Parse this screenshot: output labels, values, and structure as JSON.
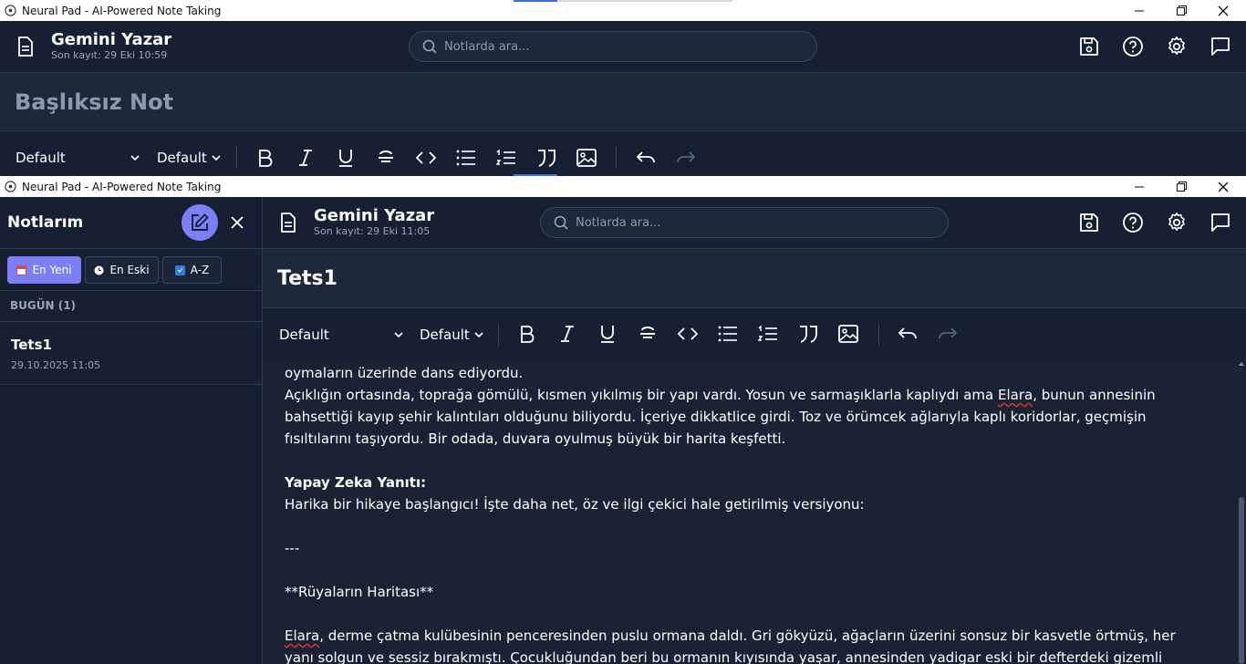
{
  "back_window": {
    "window_title": "Neural Pad - AI-Powered Note Taking",
    "app_title": "Gemini Yazar",
    "last_saved": "Son kayıt: 29 Eki 10:59",
    "search_placeholder": "Notlarda ara...",
    "note_title": "Başlıksız Not",
    "font_select": "Default",
    "size_select": "Default"
  },
  "front_window": {
    "window_title": "Neural Pad - AI-Powered Note Taking",
    "app_title": "Gemini Yazar",
    "last_saved": "Son kayıt: 29 Eki 11:05",
    "search_placeholder": "Notlarda ara...",
    "note_title": "Tets1",
    "font_select": "Default",
    "size_select": "Default"
  },
  "sidebar": {
    "title": "Notlarım",
    "sort_buttons": [
      "En Yeni",
      "En Eski",
      "A-Z"
    ],
    "group_label": "BUGÜN (1)",
    "notes": [
      {
        "title": "Tets1",
        "date": "29.10.2025 11:05"
      }
    ]
  },
  "editor": {
    "line1": "oymaların üzerinde dans ediyordu.",
    "para1_a": "Açıklığın ortasında, toprağa gömülü, kısmen yıkılmış bir yapı vardı. Yosun ve sarmaşıklarla kaplıydı ama ",
    "para1_elara": "Elara",
    "para1_b": ", bunun annesinin bahsettiği kayıp şehir kalıntıları olduğunu biliyordu. İçeriye dikkatlice girdi. Toz ve örümcek ağlarıyla kaplı koridorlar, geçmişin fısıltılarını taşıyordu. Bir odada, duvara oyulmuş büyük bir harita keşfetti.",
    "ai_heading": "Yapay Zeka Yanıtı:",
    "ai_intro": "Harika bir hikaye başlangıcı! İşte daha net, öz ve ilgi çekici hale getirilmiş versiyonu:",
    "divider": "---",
    "story_title": "**Rüyaların Haritası**",
    "story_elara": "Elara",
    "story_text": ", derme çatma kulübesinin penceresinden puslu ormana daldı. Gri gökyüzü, ağaçların üzerini sonsuz bir kasvetle örtmüş, her yanı solgun ve sessiz bırakmıştı. Çocukluğundan beri bu ormanın kıyısında yaşar, annesinden yadigar eski bir defterdeki gizemli çizimleri incelerdi. Sayfaları"
  },
  "colors": {
    "accent": "#7c7ff5",
    "bg": "#1a2234",
    "panel": "#172032"
  }
}
